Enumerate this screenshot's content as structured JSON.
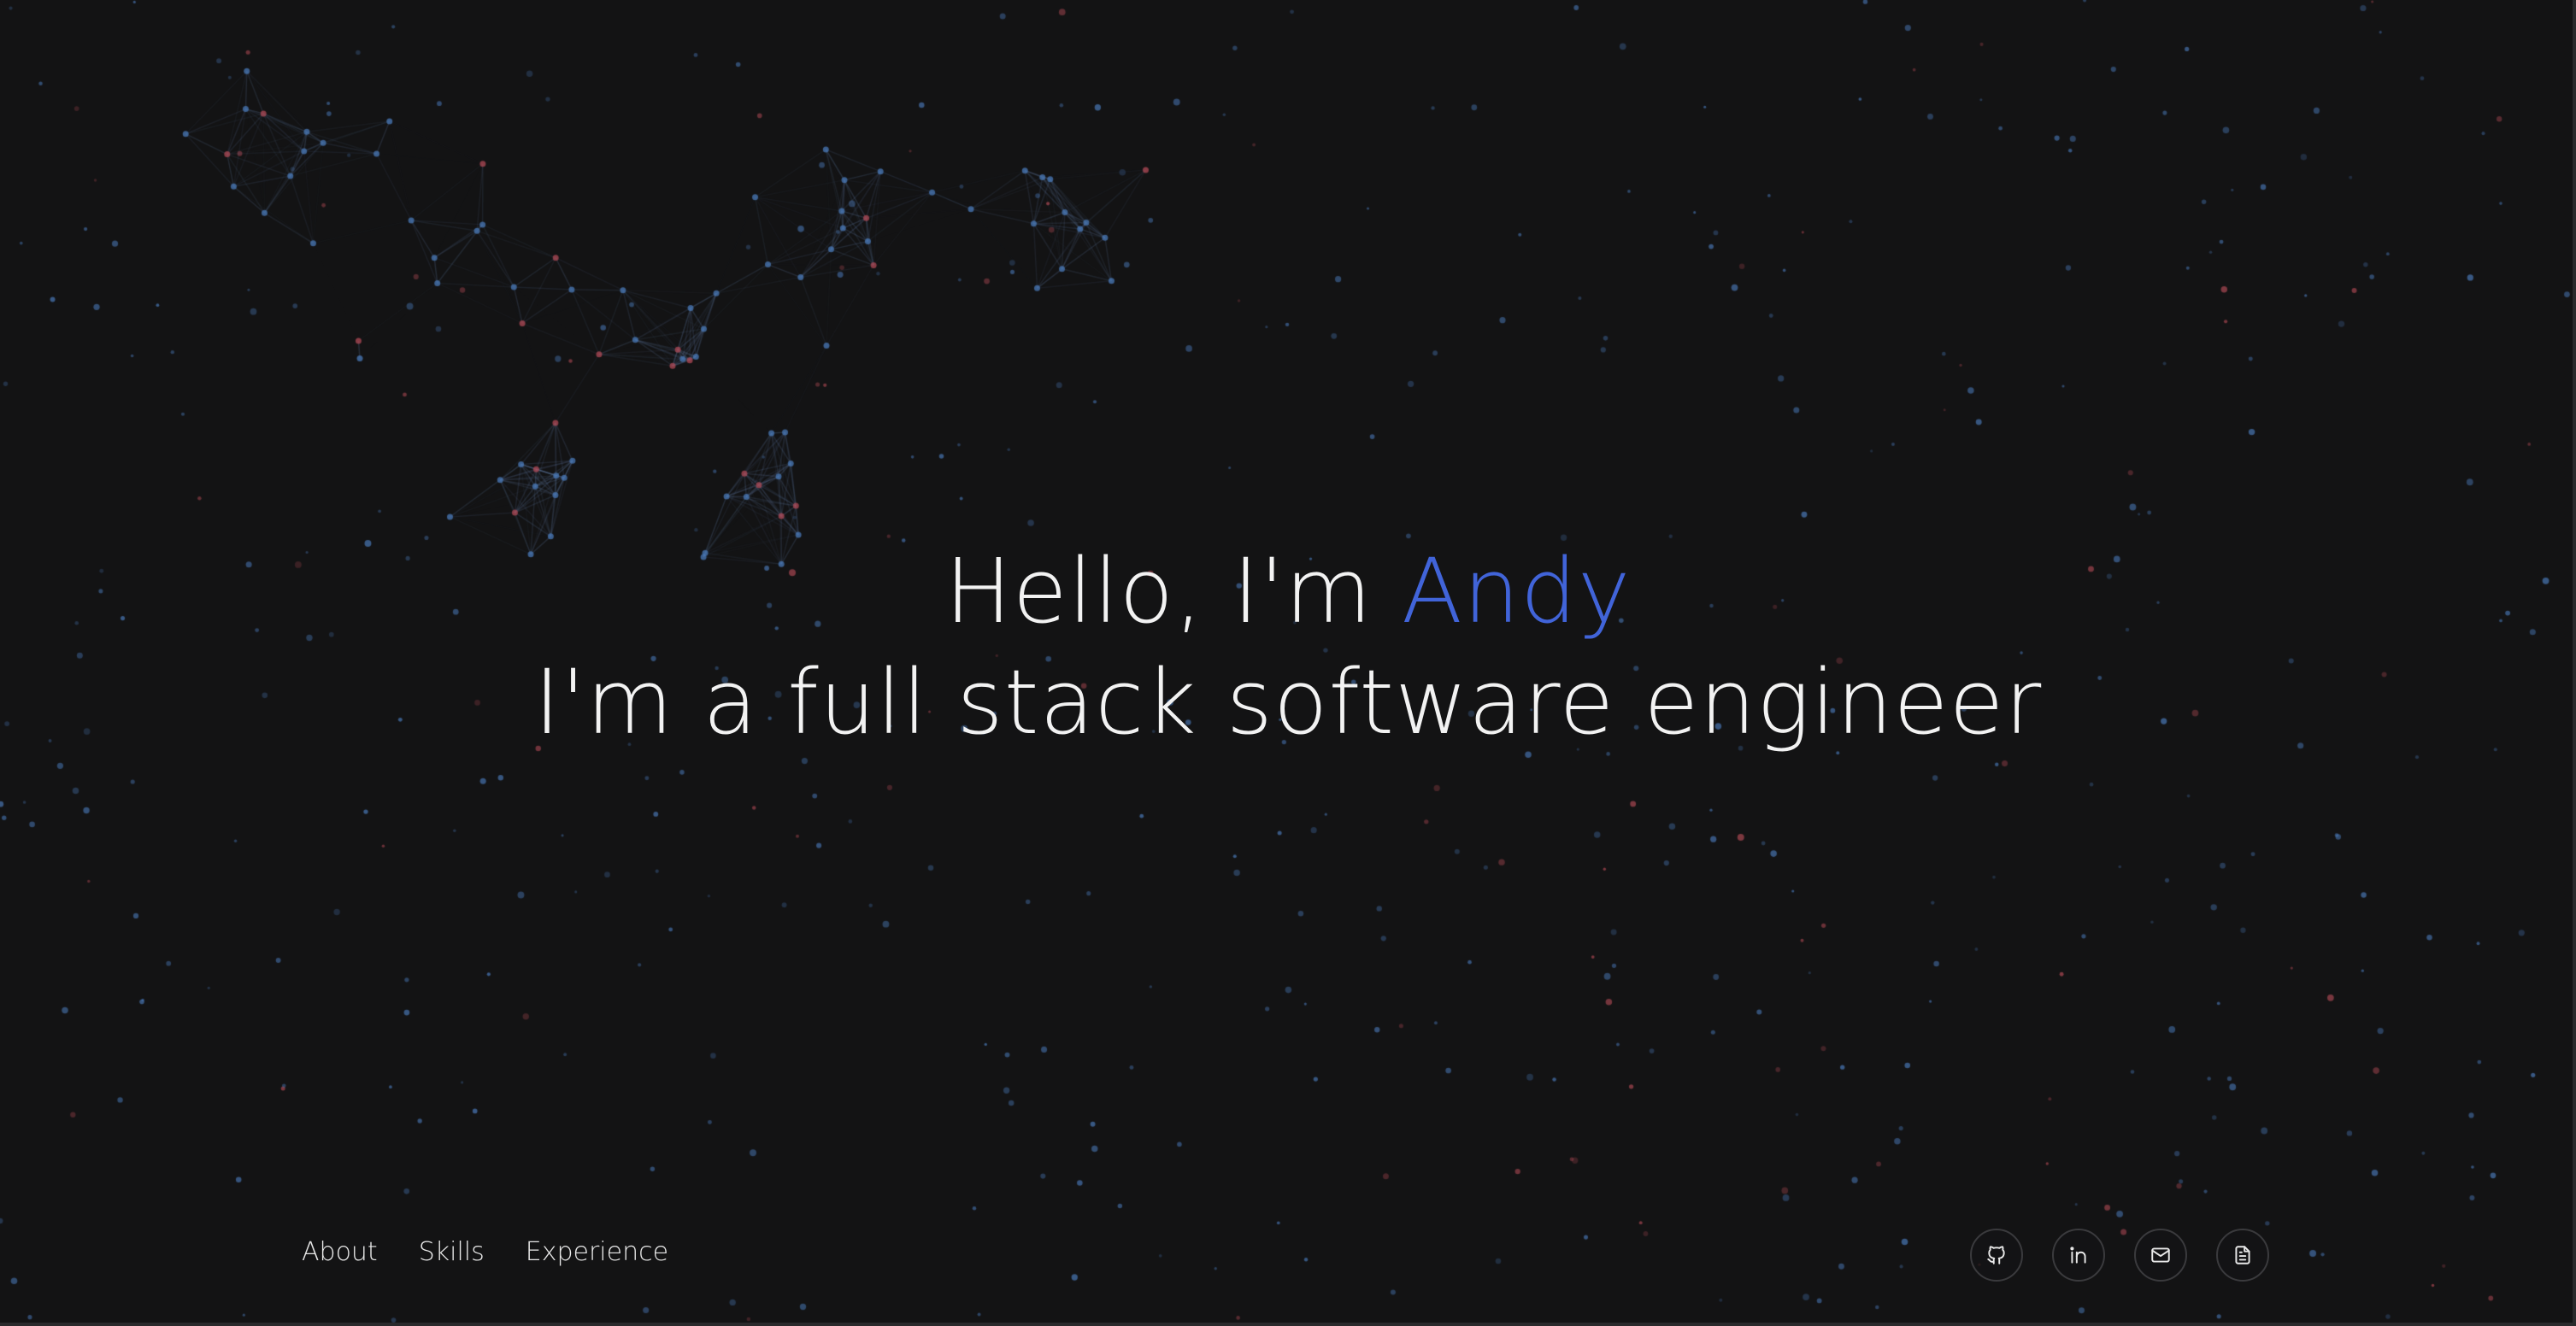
{
  "hero": {
    "greeting_prefix": "Hello, I'm ",
    "name": "Andy",
    "role": "I'm a full stack software engineer"
  },
  "nav": {
    "items": [
      {
        "label": "About"
      },
      {
        "label": "Skills"
      },
      {
        "label": "Experience"
      }
    ]
  },
  "socials": [
    {
      "icon": "github-icon"
    },
    {
      "icon": "linkedin-icon"
    },
    {
      "icon": "mail-icon"
    },
    {
      "icon": "document-icon"
    }
  ],
  "colors": {
    "background": "#131314",
    "accent": "#4164d9",
    "particle_blue": "#4a79b8",
    "particle_red": "#b04a55",
    "text": "#f2f2f2"
  }
}
